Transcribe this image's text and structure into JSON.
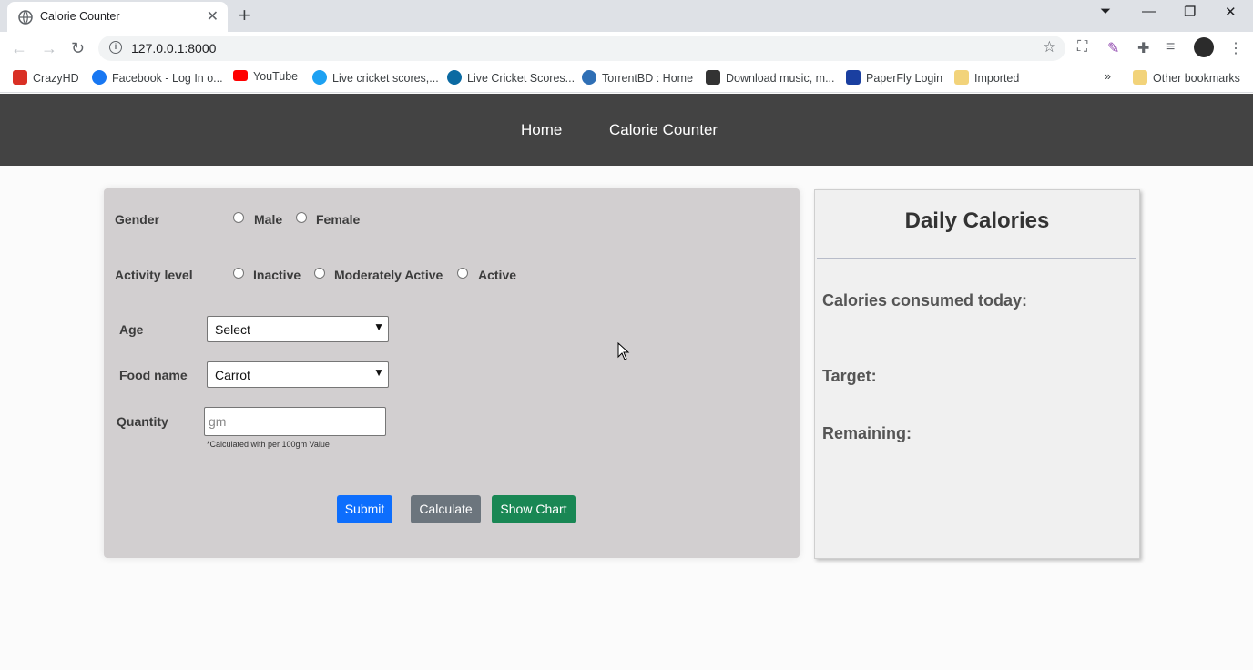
{
  "browser": {
    "tab_title": "Calorie Counter",
    "url": "127.0.0.1:8000",
    "bookmarks": [
      {
        "label": "CrazyHD",
        "color": "#d93025"
      },
      {
        "label": "Facebook - Log In o...",
        "color": "#1877f2"
      },
      {
        "label": "YouTube",
        "color": "#ff0000"
      },
      {
        "label": "Live cricket scores,...",
        "color": "#1da1f2"
      },
      {
        "label": "Live Cricket Scores...",
        "color": "#0b6aa2"
      },
      {
        "label": "TorrentBD : Home",
        "color": "#2f6fb5"
      },
      {
        "label": "Download music, m...",
        "color": "#333333"
      },
      {
        "label": "PaperFly Login",
        "color": "#1a3fa0"
      },
      {
        "label": "Imported",
        "color": "#f2d37a"
      }
    ],
    "other_bookmarks": "Other bookmarks"
  },
  "nav": {
    "home": "Home",
    "calorie_counter": "Calorie Counter"
  },
  "form": {
    "gender_label": "Gender",
    "gender_options": [
      "Male",
      "Female"
    ],
    "activity_label": "Activity level",
    "activity_options": [
      "Inactive",
      "Moderately Active",
      "Active"
    ],
    "age_label": "Age",
    "age_value": "Select",
    "food_label": "Food name",
    "food_value": "Carrot",
    "quantity_label": "Quantity",
    "quantity_placeholder": "gm",
    "quantity_note": "*Calculated with per 100gm Value",
    "submit": "Submit",
    "calculate": "Calculate",
    "show_chart": "Show Chart"
  },
  "daily": {
    "title": "Daily Calories",
    "consumed_label": "Calories consumed today:",
    "target_label": "Target:",
    "remaining_label": "Remaining:"
  },
  "colors": {
    "navbar": "#434343",
    "submit": "#0d6efd",
    "calculate": "#6c757d",
    "show_chart": "#198754"
  }
}
